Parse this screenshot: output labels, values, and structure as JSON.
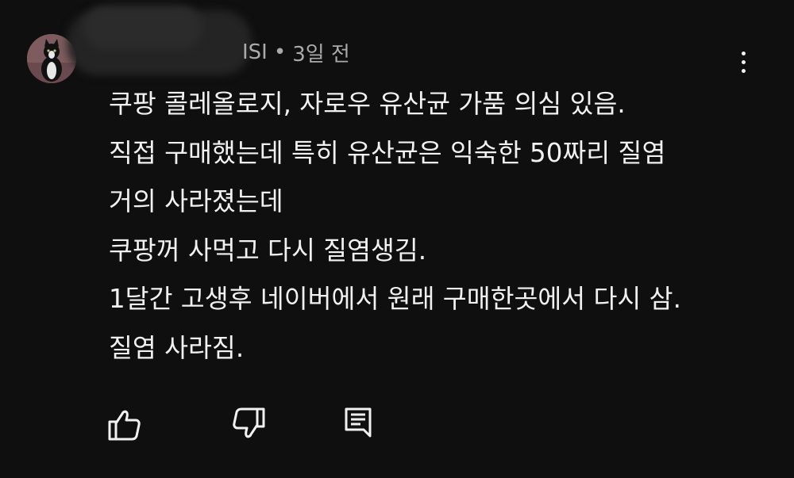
{
  "comment": {
    "author": "ISI",
    "separator": "•",
    "timestamp": "3일 전",
    "lines": [
      "쿠팡 콜레올로지, 자로우 유산균 가품  의심 있음.",
      "직접 구매했는데 특히 유산균은 익숙한 50짜리 질염",
      "거의 사라졌는데",
      "쿠팡꺼 사먹고 다시 질염생김.",
      "1달간 고생후 네이버에서 원래 구매한곳에서 다시 삼.",
      "질염 사라짐."
    ]
  },
  "icons": {
    "like": "thumbs-up-icon",
    "dislike": "thumbs-down-icon",
    "reply": "reply-comment-icon",
    "more": "more-vertical-icon"
  },
  "colors": {
    "background": "#0f0f0f",
    "text": "#f1f1f1",
    "meta": "#aaaaaa"
  }
}
